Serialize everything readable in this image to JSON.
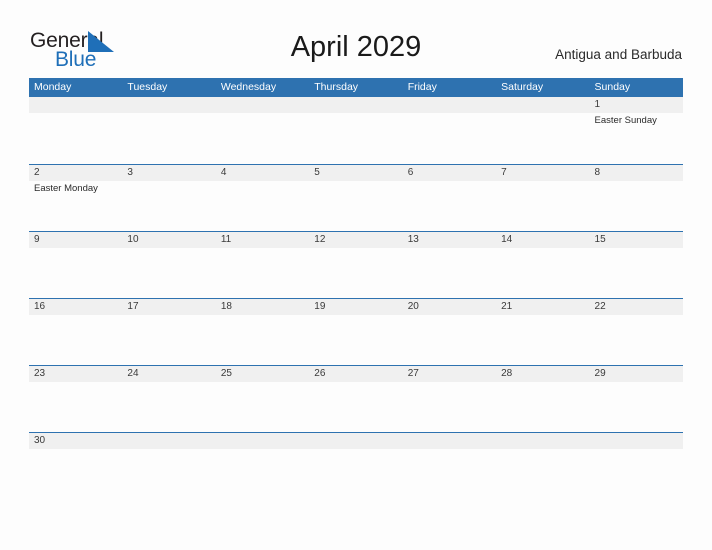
{
  "logo": {
    "word_one": "General",
    "word_two": "Blue",
    "triangle_icon": "triangle-icon",
    "accent_color": "#1F6FB8",
    "text_color": "#231F20"
  },
  "header": {
    "title": "April 2029",
    "country": "Antigua and Barbuda"
  },
  "theme": {
    "header_blue": "#2E72B0",
    "row_rule_blue": "#2E72B0",
    "date_band_gray": "#F0F0F0",
    "page_background": "#FDFDFD"
  },
  "calendar": {
    "weekdays": [
      "Monday",
      "Tuesday",
      "Wednesday",
      "Thursday",
      "Friday",
      "Saturday",
      "Sunday"
    ],
    "weeks": [
      [
        {
          "date": "",
          "event": ""
        },
        {
          "date": "",
          "event": ""
        },
        {
          "date": "",
          "event": ""
        },
        {
          "date": "",
          "event": ""
        },
        {
          "date": "",
          "event": ""
        },
        {
          "date": "",
          "event": ""
        },
        {
          "date": "1",
          "event": "Easter Sunday"
        }
      ],
      [
        {
          "date": "2",
          "event": "Easter Monday"
        },
        {
          "date": "3",
          "event": ""
        },
        {
          "date": "4",
          "event": ""
        },
        {
          "date": "5",
          "event": ""
        },
        {
          "date": "6",
          "event": ""
        },
        {
          "date": "7",
          "event": ""
        },
        {
          "date": "8",
          "event": ""
        }
      ],
      [
        {
          "date": "9",
          "event": ""
        },
        {
          "date": "10",
          "event": ""
        },
        {
          "date": "11",
          "event": ""
        },
        {
          "date": "12",
          "event": ""
        },
        {
          "date": "13",
          "event": ""
        },
        {
          "date": "14",
          "event": ""
        },
        {
          "date": "15",
          "event": ""
        }
      ],
      [
        {
          "date": "16",
          "event": ""
        },
        {
          "date": "17",
          "event": ""
        },
        {
          "date": "18",
          "event": ""
        },
        {
          "date": "19",
          "event": ""
        },
        {
          "date": "20",
          "event": ""
        },
        {
          "date": "21",
          "event": ""
        },
        {
          "date": "22",
          "event": ""
        }
      ],
      [
        {
          "date": "23",
          "event": ""
        },
        {
          "date": "24",
          "event": ""
        },
        {
          "date": "25",
          "event": ""
        },
        {
          "date": "26",
          "event": ""
        },
        {
          "date": "27",
          "event": ""
        },
        {
          "date": "28",
          "event": ""
        },
        {
          "date": "29",
          "event": ""
        }
      ],
      [
        {
          "date": "30",
          "event": ""
        },
        {
          "date": "",
          "event": ""
        },
        {
          "date": "",
          "event": ""
        },
        {
          "date": "",
          "event": ""
        },
        {
          "date": "",
          "event": ""
        },
        {
          "date": "",
          "event": ""
        },
        {
          "date": "",
          "event": ""
        }
      ]
    ]
  }
}
